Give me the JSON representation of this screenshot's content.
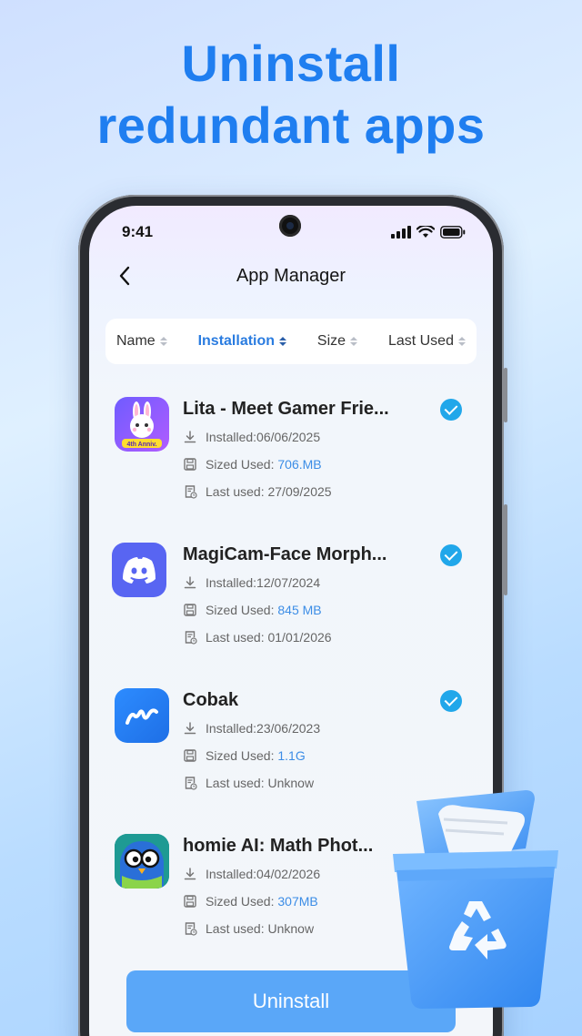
{
  "headline": {
    "line1": "Uninstall",
    "line2": "redundant apps"
  },
  "status": {
    "time": "9:41"
  },
  "nav": {
    "title": "App Manager"
  },
  "sort": {
    "items": [
      {
        "label": "Name",
        "active": false
      },
      {
        "label": "Installation",
        "active": true
      },
      {
        "label": "Size",
        "active": false
      },
      {
        "label": "Last Used",
        "active": false
      }
    ]
  },
  "apps": [
    {
      "name": "Lita - Meet Gamer Frie...",
      "installed": "Installed:06/06/2025",
      "size_label": "Sized Used: ",
      "size": "706.MB",
      "last_used": "Last used: 27/09/2025",
      "checked": true,
      "icon": "lita-bunny-icon",
      "icon_badge": "4th Anniv."
    },
    {
      "name": "MagiCam-Face Morph...",
      "installed": "Installed:12/07/2024",
      "size_label": "Sized Used: ",
      "size": "845 MB",
      "last_used": "Last used: 01/01/2026",
      "checked": true,
      "icon": "discord-icon"
    },
    {
      "name": "Cobak",
      "installed": "Installed:23/06/2023",
      "size_label": "Sized Used: ",
      "size": "1.1G",
      "last_used": "Last used: Unknow",
      "checked": true,
      "icon": "cobak-icon"
    },
    {
      "name": "homie AI: Math Phot...",
      "installed": "Installed:04/02/2026",
      "size_label": "Sized Used: ",
      "size": "307MB",
      "last_used": "Last used: Unknow",
      "checked": false,
      "icon": "owl-icon"
    }
  ],
  "action": {
    "uninstall_label": "Uninstall"
  },
  "colors": {
    "accent": "#1f7ef0",
    "check": "#21a7ea",
    "button": "#5aa7f8",
    "size_value": "#3c8de6"
  }
}
